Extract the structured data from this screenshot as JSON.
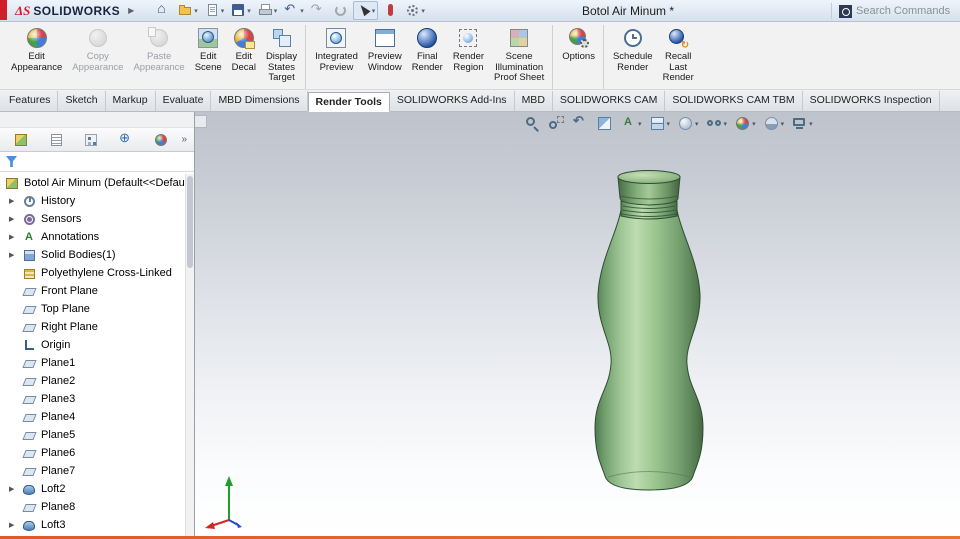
{
  "glyphs": {
    "expand_arrow": "▶",
    "caret": "▾",
    "chevrons": "»",
    "logo_arrow": "▶"
  },
  "colors": {
    "accent_red": "#d01e2b",
    "bottle_green": "#8fbf8c",
    "viewport_top": "#bec3cc",
    "selection_blue": "#4a90d9",
    "bottom_accent": "#e8742c"
  },
  "titlebar": {
    "logo_ds": "ΔS",
    "logo_text": "SOLIDWORKS",
    "document_title": "Botol Air Minum *",
    "search_text": "Search Commands",
    "icons": [
      {
        "icon": "home-icon",
        "caret": "",
        "state": ""
      },
      {
        "icon": "open-icon",
        "caret": "has-caret",
        "state": ""
      },
      {
        "icon": "new-icon",
        "caret": "has-caret",
        "state": ""
      },
      {
        "icon": "save-icon",
        "caret": "has-caret",
        "state": ""
      },
      {
        "icon": "print-icon",
        "caret": "has-caret",
        "state": ""
      },
      {
        "icon": "undo-icon",
        "caret": "has-caret",
        "state": ""
      },
      {
        "icon": "redo-icon",
        "caret": "",
        "state": ""
      },
      {
        "icon": "rebuild-icon",
        "caret": "",
        "state": ""
      },
      {
        "icon": "select-icon",
        "caret": "has-caret",
        "state": "pressed"
      },
      {
        "icon": "touch-icon",
        "caret": "",
        "state": ""
      },
      {
        "icon": "settings-icon",
        "caret": "has-caret",
        "state": ""
      }
    ]
  },
  "ribbon": {
    "buttons": [
      {
        "name": "edit-appearance-button",
        "icon": "edit-appearance-icon",
        "l1": "Edit",
        "l2": "Appearance",
        "l3": "",
        "state": ""
      },
      {
        "name": "copy-appearance-button",
        "icon": "copy-appearance-icon",
        "l1": "Copy",
        "l2": "Appearance",
        "l3": "",
        "state": "disabled"
      },
      {
        "name": "paste-appearance-button",
        "icon": "paste-appearance-icon",
        "l1": "Paste",
        "l2": "Appearance",
        "l3": "",
        "state": "disabled"
      },
      {
        "name": "edit-scene-button",
        "icon": "edit-scene-icon",
        "l1": "Edit",
        "l2": "Scene",
        "l3": "",
        "state": ""
      },
      {
        "name": "edit-decal-button",
        "icon": "edit-decal-icon",
        "l1": "Edit",
        "l2": "Decal",
        "l3": "",
        "state": ""
      },
      {
        "name": "display-states-target-button",
        "icon": "display-states-icon",
        "l1": "Display",
        "l2": "States",
        "l3": "Target",
        "state": ""
      },
      {
        "name": "integrated-preview-button",
        "icon": "integrated-preview-icon",
        "l1": "Integrated",
        "l2": "Preview",
        "l3": "",
        "state": "group-start"
      },
      {
        "name": "preview-window-button",
        "icon": "preview-window-icon",
        "l1": "Preview",
        "l2": "Window",
        "l3": "",
        "state": ""
      },
      {
        "name": "final-render-button",
        "icon": "final-render-icon",
        "l1": "Final",
        "l2": "Render",
        "l3": "",
        "state": ""
      },
      {
        "name": "render-region-button",
        "icon": "render-region-icon",
        "l1": "Render",
        "l2": "Region",
        "l3": "",
        "state": ""
      },
      {
        "name": "scene-illumination-proof-sheet-button",
        "icon": "proof-sheet-icon",
        "l1": "Scene",
        "l2": "Illumination",
        "l3": "Proof Sheet",
        "state": ""
      },
      {
        "name": "options-button",
        "icon": "options-icon",
        "l1": "Options",
        "l2": "",
        "l3": "",
        "state": "group-start"
      },
      {
        "name": "schedule-render-button",
        "icon": "schedule-render-icon",
        "l1": "Schedule",
        "l2": "Render",
        "l3": "",
        "state": "group-start"
      },
      {
        "name": "recall-last-render-button",
        "icon": "recall-render-icon",
        "l1": "Recall",
        "l2": "Last",
        "l3": "Render",
        "state": ""
      }
    ]
  },
  "tabs": [
    {
      "label": "Features",
      "state": ""
    },
    {
      "label": "Sketch",
      "state": ""
    },
    {
      "label": "Markup",
      "state": ""
    },
    {
      "label": "Evaluate",
      "state": ""
    },
    {
      "label": "MBD Dimensions",
      "state": ""
    },
    {
      "label": "Render Tools",
      "state": "active"
    },
    {
      "label": "SOLIDWORKS Add-Ins",
      "state": ""
    },
    {
      "label": "MBD",
      "state": ""
    },
    {
      "label": "SOLIDWORKS CAM",
      "state": ""
    },
    {
      "label": "SOLIDWORKS CAM TBM",
      "state": ""
    },
    {
      "label": "SOLIDWORKS Inspection",
      "state": ""
    }
  ],
  "feature_tree": {
    "panel_tabs": [
      "features-manager-icon",
      "property-manager-icon",
      "configuration-manager-icon",
      "dimxpert-manager-icon",
      "display-manager-icon"
    ],
    "items": [
      {
        "label": "Botol Air Minum  (Default<<Defau",
        "icon": "part-icon",
        "arrow": "",
        "state": "root"
      },
      {
        "label": "History",
        "icon": "history-icon",
        "arrow": "has-arrow",
        "state": ""
      },
      {
        "label": "Sensors",
        "icon": "sensors-icon",
        "arrow": "has-arrow",
        "state": ""
      },
      {
        "label": "Annotations",
        "icon": "annotations-icon",
        "arrow": "has-arrow",
        "state": ""
      },
      {
        "label": "Solid Bodies(1)",
        "icon": "bodies-icon",
        "arrow": "has-arrow",
        "state": ""
      },
      {
        "label": "Polyethylene Cross-Linked",
        "icon": "material-icon",
        "arrow": "",
        "state": ""
      },
      {
        "label": "Front Plane",
        "icon": "plane-icon",
        "arrow": "",
        "state": ""
      },
      {
        "label": "Top Plane",
        "icon": "plane-icon",
        "arrow": "",
        "state": ""
      },
      {
        "label": "Right Plane",
        "icon": "plane-icon",
        "arrow": "",
        "state": ""
      },
      {
        "label": "Origin",
        "icon": "origin-icon",
        "arrow": "",
        "state": ""
      },
      {
        "label": "Plane1",
        "icon": "plane-icon",
        "arrow": "",
        "state": ""
      },
      {
        "label": "Plane2",
        "icon": "plane-icon",
        "arrow": "",
        "state": ""
      },
      {
        "label": "Plane3",
        "icon": "plane-icon",
        "arrow": "",
        "state": ""
      },
      {
        "label": "Plane4",
        "icon": "plane-icon",
        "arrow": "",
        "state": ""
      },
      {
        "label": "Plane5",
        "icon": "plane-icon",
        "arrow": "",
        "state": ""
      },
      {
        "label": "Plane6",
        "icon": "plane-icon",
        "arrow": "",
        "state": ""
      },
      {
        "label": "Plane7",
        "icon": "plane-icon",
        "arrow": "",
        "state": ""
      },
      {
        "label": "Loft2",
        "icon": "loft-icon",
        "arrow": "has-arrow",
        "state": ""
      },
      {
        "label": "Plane8",
        "icon": "plane-icon",
        "arrow": "",
        "state": ""
      },
      {
        "label": "Loft3",
        "icon": "loft-icon",
        "arrow": "has-arrow",
        "state": ""
      }
    ]
  },
  "viewport": {
    "model_color": "#8fbf8c",
    "hud_icons": [
      {
        "icon": "zoom-fit-icon",
        "caret": ""
      },
      {
        "icon": "zoom-area-icon",
        "caret": ""
      },
      {
        "icon": "previous-view-icon",
        "caret": ""
      },
      {
        "icon": "section-view-icon",
        "caret": ""
      },
      {
        "icon": "annotation-views-icon",
        "caret": "has-caret"
      },
      {
        "icon": "view-orientation-icon",
        "caret": "has-caret"
      },
      {
        "icon": "display-style-icon",
        "caret": "has-caret"
      },
      {
        "icon": "hide-show-icon",
        "caret": "has-caret"
      },
      {
        "icon": "edit-appearance-hud-icon",
        "caret": "has-caret"
      },
      {
        "icon": "apply-scene-icon",
        "caret": "has-caret"
      },
      {
        "icon": "view-settings-icon",
        "caret": "has-caret"
      }
    ]
  }
}
